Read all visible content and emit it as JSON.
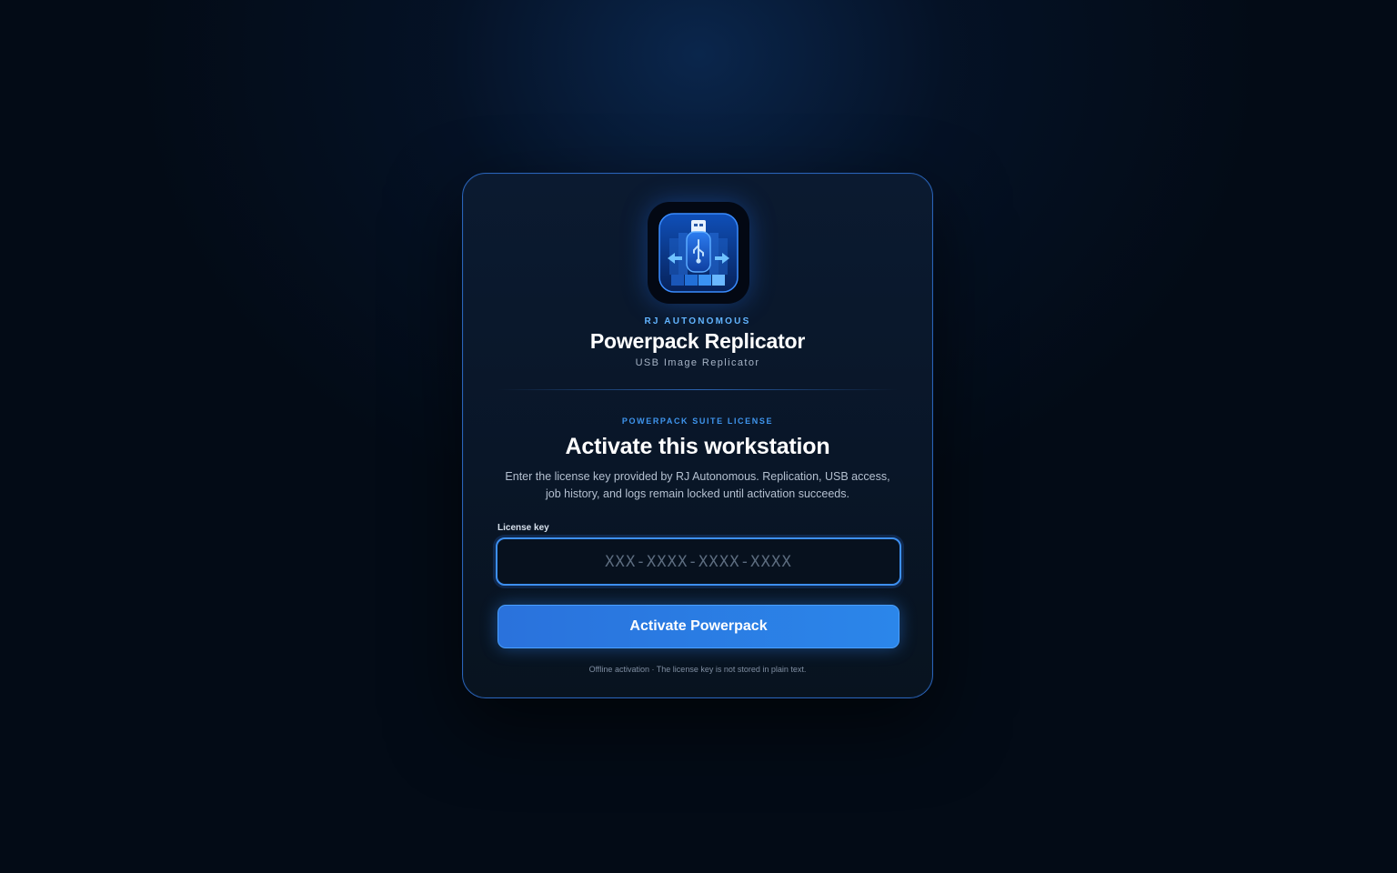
{
  "app": {
    "brand": "RJ AUTONOMOUS",
    "title": "Powerpack Replicator",
    "subtitle": "USB Image Replicator",
    "icon": "usb-drive-icon"
  },
  "activation": {
    "eyebrow": "POWERPACK SUITE LICENSE",
    "heading": "Activate this workstation",
    "description": "Enter the license key provided by RJ Autonomous. Replication, USB access, job history, and logs remain locked until activation succeeds.",
    "license_label": "License key",
    "license_placeholder": "XXX-XXXX-XXXX-XXXX",
    "license_value": "",
    "button_label": "Activate Powerpack",
    "footnote": "Offline activation · The license key is not stored in plain text."
  },
  "colors": {
    "accent": "#2b7fe6",
    "accent_light": "#62b4ff",
    "card_border": "#2a63b8",
    "background": "#030b16"
  }
}
